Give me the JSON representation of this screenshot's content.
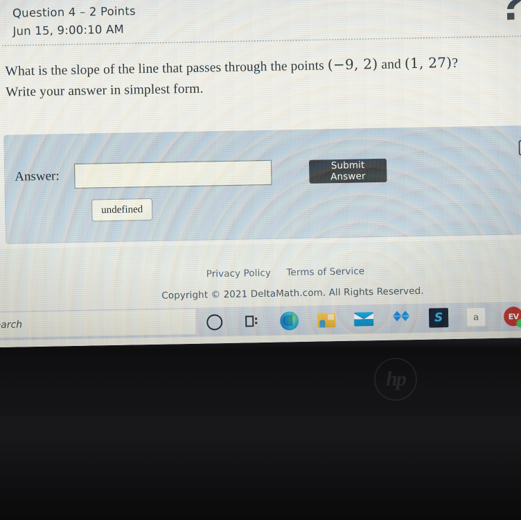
{
  "question": {
    "title": "Question 4 – 2 Points",
    "timestamp": "Jun 15, 9:00:10 AM",
    "prompt_line1_a": "What is the slope of the line that passes through the points ",
    "prompt_points": "(−9, 2)",
    "prompt_and": " and ",
    "prompt_points2": "(1, 27)",
    "prompt_qmark": "?",
    "prompt_line2": "Write your answer in simplest form.",
    "help_icon": "question-mark-icon"
  },
  "answer_panel": {
    "label": "Answer:",
    "input_value": "",
    "input_placeholder": "",
    "submit_label": "Submit Answer",
    "undefined_label": "undefined",
    "keyboard_icon": "keyboard-icon",
    "circle_icon": "circle-icon"
  },
  "footer": {
    "privacy": "Privacy Policy",
    "terms": "Terms of Service",
    "copyright": "Copyright © 2021 DeltaMath.com. All Rights Reserved."
  },
  "taskbar": {
    "search_text": "o search",
    "items": [
      {
        "name": "cortana-icon",
        "label": ""
      },
      {
        "name": "task-view-icon",
        "label": ""
      },
      {
        "name": "edge-browser-icon",
        "label": ""
      },
      {
        "name": "file-explorer-icon",
        "label": ""
      },
      {
        "name": "mail-icon",
        "label": ""
      },
      {
        "name": "dropbox-icon",
        "label": ""
      },
      {
        "name": "s-app-icon",
        "label": "S"
      },
      {
        "name": "a-tile-icon",
        "label": "a"
      },
      {
        "name": "ev-badge-icon",
        "label": "EV"
      }
    ]
  },
  "device": {
    "brand_logo": "hp"
  },
  "colors": {
    "panel": "#bcc6cf",
    "submit_button": "#3b3c3e",
    "page": "#ecead f",
    "text": "#2a2d31",
    "taskbar": "#c9ccd3"
  }
}
